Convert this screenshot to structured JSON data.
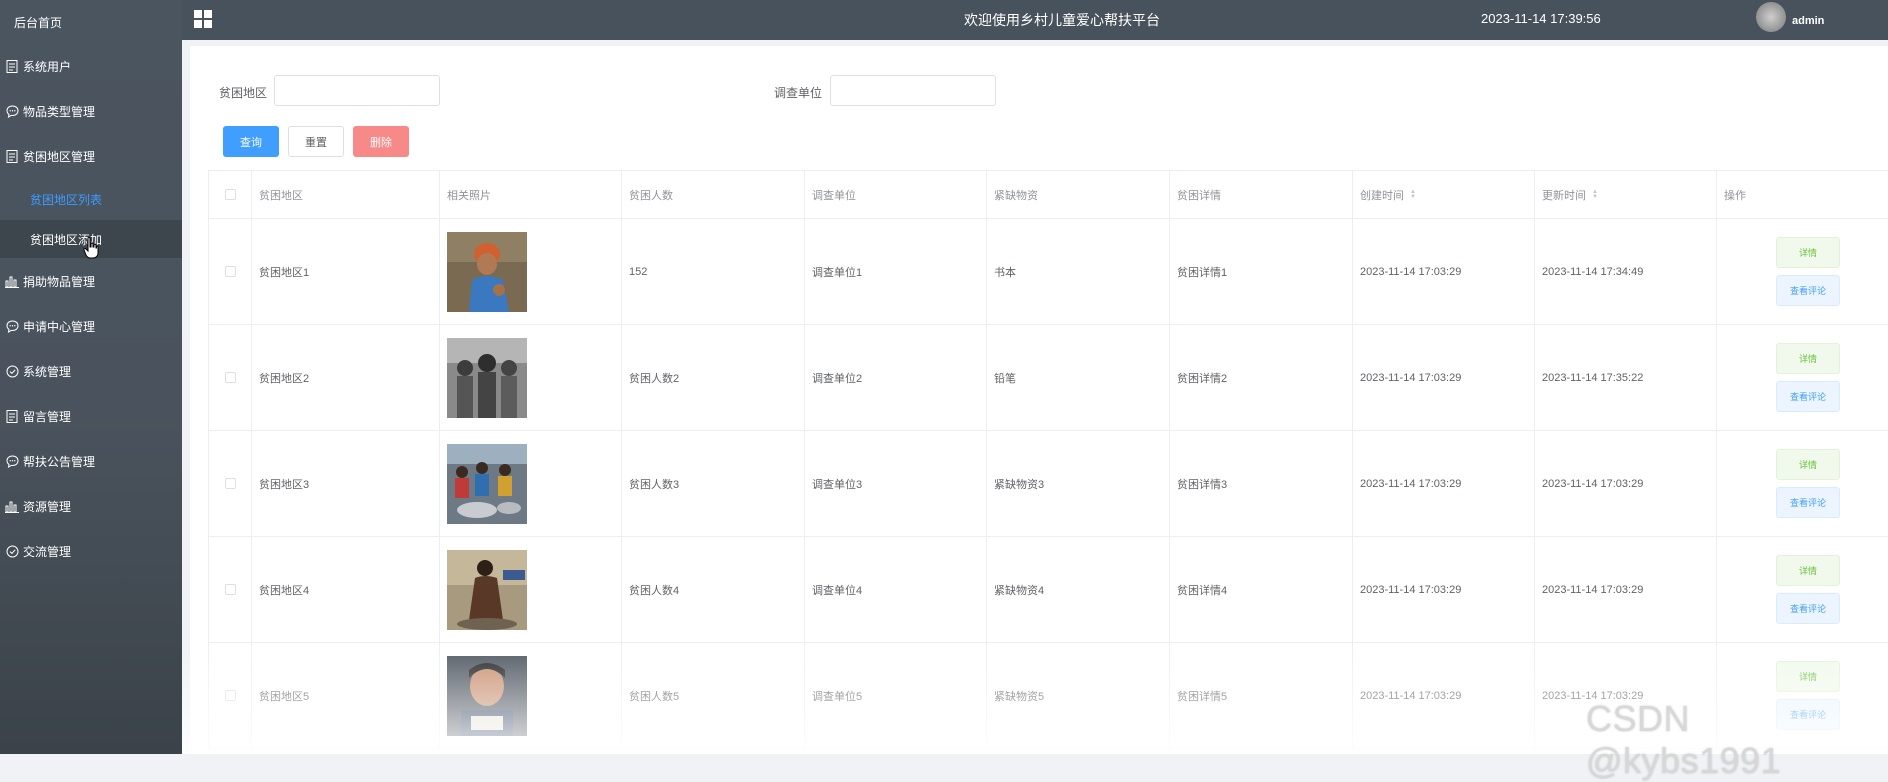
{
  "sidebar": {
    "home": "后台首页",
    "items": [
      {
        "label": "系统用户",
        "icon": "document-icon"
      },
      {
        "label": "物品类型管理",
        "icon": "chat-icon"
      },
      {
        "label": "贫困地区管理",
        "icon": "document-icon"
      },
      {
        "label": "捐助物品管理",
        "icon": "bar-chart-icon"
      },
      {
        "label": "申请中心管理",
        "icon": "chat-icon"
      },
      {
        "label": "系统管理",
        "icon": "check-circle-icon"
      },
      {
        "label": "留言管理",
        "icon": "document-icon"
      },
      {
        "label": "帮扶公告管理",
        "icon": "chat-icon"
      },
      {
        "label": "资源管理",
        "icon": "bar-chart-icon"
      },
      {
        "label": "交流管理",
        "icon": "check-circle-icon"
      }
    ],
    "subitems": [
      {
        "label": "贫困地区列表",
        "state": "active"
      },
      {
        "label": "贫困地区添加",
        "state": "hover"
      }
    ],
    "active_color": "#3b9cff"
  },
  "topbar": {
    "title": "欢迎使用乡村儿童爱心帮扶平台",
    "datetime": "2023-11-14 17:39:56",
    "username": "admin"
  },
  "filters": {
    "region_label": "贫困地区",
    "region_value": "",
    "unit_label": "调查单位",
    "unit_value": ""
  },
  "buttons": {
    "query": "查询",
    "reset": "重置",
    "delete": "删除"
  },
  "table": {
    "headers": [
      "贫困地区",
      "相关照片",
      "贫困人数",
      "调查单位",
      "紧缺物资",
      "贫困详情",
      "创建时间",
      "更新时间",
      "操作"
    ],
    "rows": [
      {
        "region": "贫困地区1",
        "count": "152",
        "unit": "调查单位1",
        "supplies": "书本",
        "detail": "贫困详情1",
        "created": "2023-11-14 17:03:29",
        "updated": "2023-11-14 17:34:49"
      },
      {
        "region": "贫困地区2",
        "count": "贫困人数2",
        "unit": "调查单位2",
        "supplies": "铅笔",
        "detail": "贫困详情2",
        "created": "2023-11-14 17:03:29",
        "updated": "2023-11-14 17:35:22"
      },
      {
        "region": "贫困地区3",
        "count": "贫困人数3",
        "unit": "调查单位3",
        "supplies": "紧缺物资3",
        "detail": "贫困详情3",
        "created": "2023-11-14 17:03:29",
        "updated": "2023-11-14 17:03:29"
      },
      {
        "region": "贫困地区4",
        "count": "贫困人数4",
        "unit": "调查单位4",
        "supplies": "紧缺物资4",
        "detail": "贫困详情4",
        "created": "2023-11-14 17:03:29",
        "updated": "2023-11-14 17:03:29"
      },
      {
        "region": "贫困地区5",
        "count": "贫困人数5",
        "unit": "调查单位5",
        "supplies": "紧缺物资5",
        "detail": "贫困详情5",
        "created": "2023-11-14 17:03:29",
        "updated": "2023-11-14 17:03:29"
      }
    ],
    "op_detail": "详情",
    "op_comment": "查看评论"
  },
  "watermark": "CSDN @kybs1991"
}
